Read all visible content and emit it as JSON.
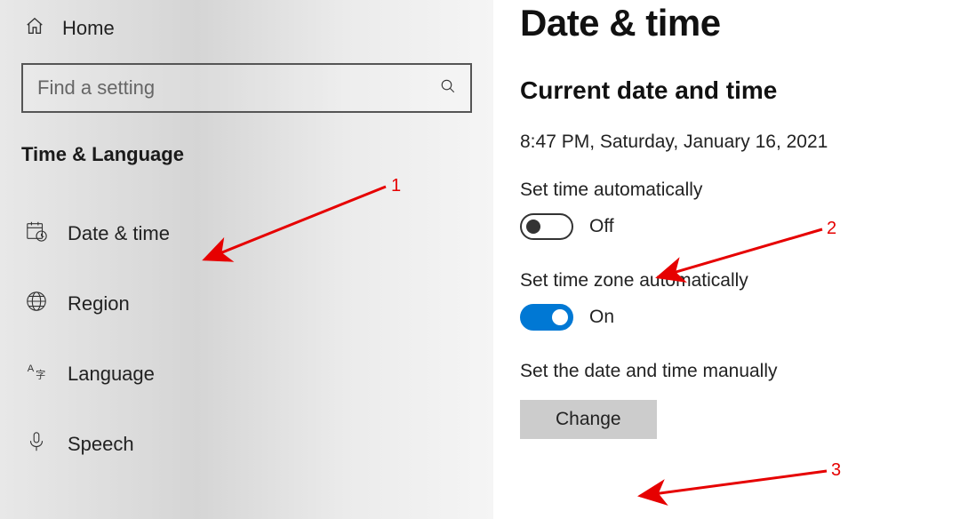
{
  "sidebar": {
    "home_label": "Home",
    "search_placeholder": "Find a setting",
    "section_title": "Time & Language",
    "items": [
      {
        "label": "Date & time"
      },
      {
        "label": "Region"
      },
      {
        "label": "Language"
      },
      {
        "label": "Speech"
      }
    ]
  },
  "main": {
    "page_title": "Date & time",
    "section_heading": "Current date and time",
    "current_datetime": "8:47 PM, Saturday, January 16, 2021",
    "set_time_auto_label": "Set time automatically",
    "set_time_auto_state": "Off",
    "set_tz_auto_label": "Set time zone automatically",
    "set_tz_auto_state": "On",
    "set_manual_label": "Set the date and time manually",
    "change_button_label": "Change"
  },
  "annotations": {
    "a1": "1",
    "a2": "2",
    "a3": "3"
  }
}
